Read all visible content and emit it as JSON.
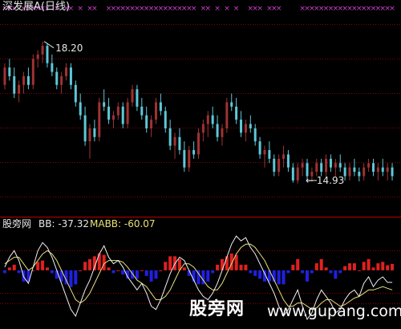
{
  "chart_data": [
    {
      "type": "candlestick",
      "title": "深发展A(日线)",
      "annotations": [
        {
          "text": "18.20",
          "marks": "high",
          "x": 8
        },
        {
          "text": "14.93",
          "marks": "low",
          "x": 64
        }
      ],
      "ylim": [
        14.5,
        18.6
      ],
      "grid": true,
      "signal_marker": "×",
      "signal_indices": [
        0,
        1,
        2,
        4,
        5,
        6,
        7,
        8,
        9,
        11,
        13,
        14,
        16,
        18,
        19,
        22,
        23,
        24,
        25,
        26,
        27,
        28,
        29,
        30,
        31,
        32,
        33,
        34,
        35,
        36,
        37,
        38,
        39,
        40,
        42,
        43,
        45,
        47,
        49,
        52,
        53,
        54,
        56,
        57,
        58,
        63,
        64,
        65,
        66,
        67,
        68,
        69,
        70,
        71,
        72,
        73,
        74,
        75,
        76,
        77,
        78,
        79,
        80,
        81,
        82
      ],
      "colors": {
        "up": "#a03232",
        "down": "#5ec8d8",
        "grid": "#8b0000",
        "signal": "#d040d0"
      },
      "candles": [
        [
          17.2,
          17.7,
          17.1,
          17.6
        ],
        [
          17.6,
          17.8,
          17.3,
          17.4
        ],
        [
          17.4,
          17.6,
          16.9,
          17.0
        ],
        [
          17.0,
          17.3,
          16.8,
          17.2
        ],
        [
          17.2,
          17.5,
          17.0,
          17.4
        ],
        [
          17.4,
          17.6,
          17.1,
          17.2
        ],
        [
          17.2,
          17.9,
          17.1,
          17.8
        ],
        [
          17.8,
          18.0,
          17.6,
          17.9
        ],
        [
          17.9,
          18.2,
          17.7,
          18.1
        ],
        [
          18.1,
          18.15,
          17.6,
          17.7
        ],
        [
          17.7,
          17.9,
          17.4,
          17.5
        ],
        [
          17.5,
          17.6,
          17.1,
          17.2
        ],
        [
          17.2,
          17.5,
          17.0,
          17.4
        ],
        [
          17.4,
          17.7,
          17.3,
          17.6
        ],
        [
          17.6,
          17.7,
          17.1,
          17.2
        ],
        [
          17.2,
          17.3,
          16.7,
          16.8
        ],
        [
          16.8,
          17.0,
          16.4,
          16.5
        ],
        [
          16.5,
          16.7,
          15.8,
          15.9
        ],
        [
          15.9,
          16.3,
          15.5,
          16.2
        ],
        [
          16.2,
          16.4,
          15.9,
          16.0
        ],
        [
          16.0,
          16.9,
          15.9,
          16.8
        ],
        [
          16.8,
          17.1,
          16.6,
          16.7
        ],
        [
          16.7,
          16.9,
          16.3,
          16.4
        ],
        [
          16.4,
          16.6,
          16.2,
          16.5
        ],
        [
          16.5,
          16.8,
          16.4,
          16.7
        ],
        [
          16.7,
          16.8,
          16.2,
          16.3
        ],
        [
          16.3,
          16.9,
          16.2,
          16.8
        ],
        [
          16.8,
          17.2,
          16.7,
          17.1
        ],
        [
          17.1,
          17.2,
          16.6,
          16.7
        ],
        [
          16.7,
          16.9,
          16.4,
          16.5
        ],
        [
          16.5,
          16.7,
          16.1,
          16.2
        ],
        [
          16.2,
          16.5,
          16.0,
          16.4
        ],
        [
          16.4,
          16.9,
          16.3,
          16.8
        ],
        [
          16.8,
          17.0,
          16.5,
          16.6
        ],
        [
          16.6,
          16.7,
          16.1,
          16.2
        ],
        [
          16.2,
          16.4,
          15.7,
          15.8
        ],
        [
          15.8,
          16.1,
          15.5,
          16.0
        ],
        [
          16.0,
          16.2,
          15.6,
          15.7
        ],
        [
          15.7,
          15.9,
          15.2,
          15.3
        ],
        [
          15.3,
          15.8,
          15.2,
          15.7
        ],
        [
          15.7,
          15.9,
          15.5,
          15.6
        ],
        [
          15.6,
          16.2,
          15.5,
          16.1
        ],
        [
          16.1,
          16.4,
          15.9,
          16.3
        ],
        [
          16.3,
          16.6,
          16.0,
          16.5
        ],
        [
          16.5,
          16.7,
          16.2,
          16.3
        ],
        [
          16.3,
          16.5,
          15.9,
          16.0
        ],
        [
          16.0,
          16.3,
          15.8,
          16.2
        ],
        [
          16.2,
          16.9,
          16.1,
          16.8
        ],
        [
          16.8,
          17.0,
          16.6,
          16.7
        ],
        [
          16.7,
          16.9,
          16.3,
          16.4
        ],
        [
          16.4,
          16.6,
          16.0,
          16.1
        ],
        [
          16.1,
          16.4,
          15.9,
          16.3
        ],
        [
          16.3,
          16.5,
          16.1,
          16.2
        ],
        [
          16.2,
          16.3,
          15.8,
          15.9
        ],
        [
          15.9,
          16.0,
          15.5,
          15.6
        ],
        [
          15.6,
          15.8,
          15.3,
          15.7
        ],
        [
          15.7,
          15.9,
          15.4,
          15.5
        ],
        [
          15.5,
          15.6,
          15.1,
          15.2
        ],
        [
          15.2,
          15.6,
          15.1,
          15.5
        ],
        [
          15.5,
          15.8,
          15.3,
          15.6
        ],
        [
          15.6,
          15.7,
          15.2,
          15.3
        ],
        [
          15.3,
          15.4,
          14.95,
          15.0
        ],
        [
          15.0,
          15.4,
          14.93,
          15.3
        ],
        [
          15.3,
          15.5,
          15.1,
          15.4
        ],
        [
          15.4,
          15.5,
          15.0,
          15.1
        ],
        [
          15.1,
          15.3,
          14.98,
          15.2
        ],
        [
          15.2,
          15.5,
          15.1,
          15.4
        ],
        [
          15.4,
          15.5,
          15.1,
          15.2
        ],
        [
          15.2,
          15.6,
          15.1,
          15.5
        ],
        [
          15.5,
          15.6,
          15.2,
          15.3
        ],
        [
          15.3,
          15.5,
          15.1,
          15.4
        ],
        [
          15.4,
          15.6,
          15.2,
          15.3
        ],
        [
          15.3,
          15.4,
          15.0,
          15.1
        ],
        [
          15.1,
          15.4,
          15.0,
          15.3
        ],
        [
          15.3,
          15.5,
          15.1,
          15.2
        ],
        [
          15.2,
          15.3,
          14.98,
          15.1
        ],
        [
          15.1,
          15.4,
          15.0,
          15.3
        ],
        [
          15.3,
          15.5,
          15.2,
          15.4
        ],
        [
          15.4,
          15.5,
          15.1,
          15.2
        ],
        [
          15.2,
          15.4,
          15.0,
          15.3
        ],
        [
          15.3,
          15.5,
          15.1,
          15.2
        ],
        [
          15.2,
          15.4,
          15.0,
          15.3
        ],
        [
          15.3,
          15.4,
          15.0,
          15.1
        ]
      ]
    },
    {
      "type": "line",
      "title": "股旁网",
      "labels": {
        "bb": "BB: -37.32",
        "mabb": "MABB: -60.07"
      },
      "ylim": [
        -160,
        120
      ],
      "grid": true,
      "colors": {
        "bb": "#f0f0f0",
        "mabb": "#e8e07a",
        "bar_pos": "#e02020",
        "bar_neg": "#2020e0",
        "grid": "#8b0000"
      },
      "bb": [
        10,
        40,
        60,
        30,
        -20,
        -40,
        10,
        60,
        85,
        70,
        40,
        0,
        -40,
        -80,
        -120,
        -140,
        -100,
        -60,
        -30,
        10,
        50,
        75,
        40,
        20,
        30,
        10,
        -20,
        -40,
        -60,
        -40,
        -70,
        -110,
        -120,
        -90,
        -50,
        -10,
        20,
        40,
        30,
        0,
        -30,
        -60,
        -80,
        -90,
        -70,
        -40,
        0,
        40,
        80,
        105,
        90,
        100,
        70,
        50,
        20,
        -10,
        -40,
        -70,
        -110,
        -140,
        -120,
        -90,
        -60,
        -110,
        -150,
        -130,
        -90,
        -60,
        -80,
        -100,
        -130,
        -120,
        -90,
        -70,
        -60,
        -80,
        -40,
        -20,
        -50,
        -30,
        -20,
        -37,
        -37
      ],
      "mabb": [
        20,
        30,
        40,
        40,
        20,
        0,
        10,
        30,
        50,
        60,
        50,
        30,
        0,
        -30,
        -60,
        -90,
        -100,
        -90,
        -70,
        -40,
        -10,
        20,
        30,
        30,
        30,
        25,
        10,
        -10,
        -30,
        -40,
        -50,
        -70,
        -90,
        -90,
        -80,
        -60,
        -30,
        0,
        20,
        20,
        10,
        -10,
        -30,
        -50,
        -60,
        -60,
        -40,
        -10,
        20,
        50,
        70,
        80,
        80,
        70,
        50,
        30,
        0,
        -30,
        -60,
        -90,
        -110,
        -110,
        -100,
        -100,
        -110,
        -120,
        -115,
        -100,
        -90,
        -90,
        -100,
        -110,
        -105,
        -95,
        -85,
        -80,
        -70,
        -60,
        -60,
        -55,
        -50,
        -55,
        -60
      ]
    }
  ],
  "watermark": {
    "brand": "股旁网",
    "url": "www.gupang.com"
  }
}
